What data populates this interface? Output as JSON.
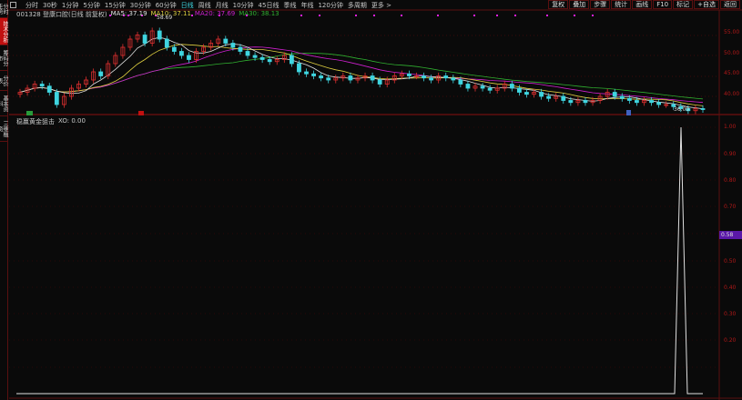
{
  "sidebar": {
    "tabs": [
      "分时走势",
      "技术分析",
      "筹码分布",
      "分价表",
      "基本资料",
      "三维融资"
    ],
    "active": 1
  },
  "topbar": {
    "periods": [
      "分时",
      "30秒",
      "1分钟",
      "5分钟",
      "15分钟",
      "30分钟",
      "60分钟",
      "日线",
      "周线",
      "月线",
      "10分钟",
      "45日线",
      "季线",
      "年线",
      "120分钟",
      "多周期",
      "更多 >"
    ],
    "active": "日线",
    "right_buttons": [
      "复权",
      "叠加",
      "步骤",
      "统计",
      "画线",
      "F10",
      "标记",
      "+自选",
      "返回"
    ]
  },
  "info": {
    "code_name": "001328 登康口腔(日线 前复权)",
    "ma5": "MA5: 37.19",
    "ma10": "MA10: 37.11",
    "ma20": "MA20: 37.69",
    "ma30": "MA30: 38.13"
  },
  "colors": {
    "up": "#e03030",
    "down": "#3fd5e0",
    "ma5": "#e0e0e0",
    "ma10": "#e0d040",
    "ma20": "#d020d0",
    "ma30": "#30b030",
    "axis": "#b01818",
    "highlight": "#5a18a8"
  },
  "price_axis": [
    "55.00",
    "50.00",
    "45.00",
    "40.00"
  ],
  "annotations": {
    "high": "58.69",
    "low": "36.00"
  },
  "indicator": {
    "title": "稳赢黄金狙击",
    "xo": "XO: 0.00",
    "axis": [
      "1.00",
      "0.90",
      "0.80",
      "0.70",
      "0.50",
      "0.40",
      "0.30",
      "0.20"
    ],
    "current": "0.58",
    "spike_value": 1.0
  },
  "chart_data": {
    "type": "candlestick",
    "closes": [
      41,
      42,
      43,
      42.5,
      41,
      38,
      40,
      42,
      43,
      44,
      46,
      45,
      48,
      50,
      52,
      54,
      55,
      53,
      56,
      54,
      52,
      51,
      50,
      49,
      51,
      52,
      53,
      54,
      53,
      52,
      51,
      50,
      49.5,
      49,
      48.5,
      49,
      50,
      48,
      46,
      45.5,
      45,
      44.5,
      44,
      44.5,
      45,
      44,
      44.5,
      45,
      44,
      43,
      44,
      45,
      45.5,
      45,
      45,
      44.5,
      44,
      45,
      44.5,
      44,
      43,
      42,
      42.5,
      42,
      41.5,
      42,
      43,
      42,
      41,
      40.5,
      41,
      40,
      39.5,
      40,
      39,
      38.5,
      39,
      38.5,
      39,
      40,
      41,
      40,
      39.5,
      39,
      38.5,
      39,
      38.5,
      38,
      38,
      37.5,
      37,
      36.5,
      37,
      36.8
    ]
  }
}
